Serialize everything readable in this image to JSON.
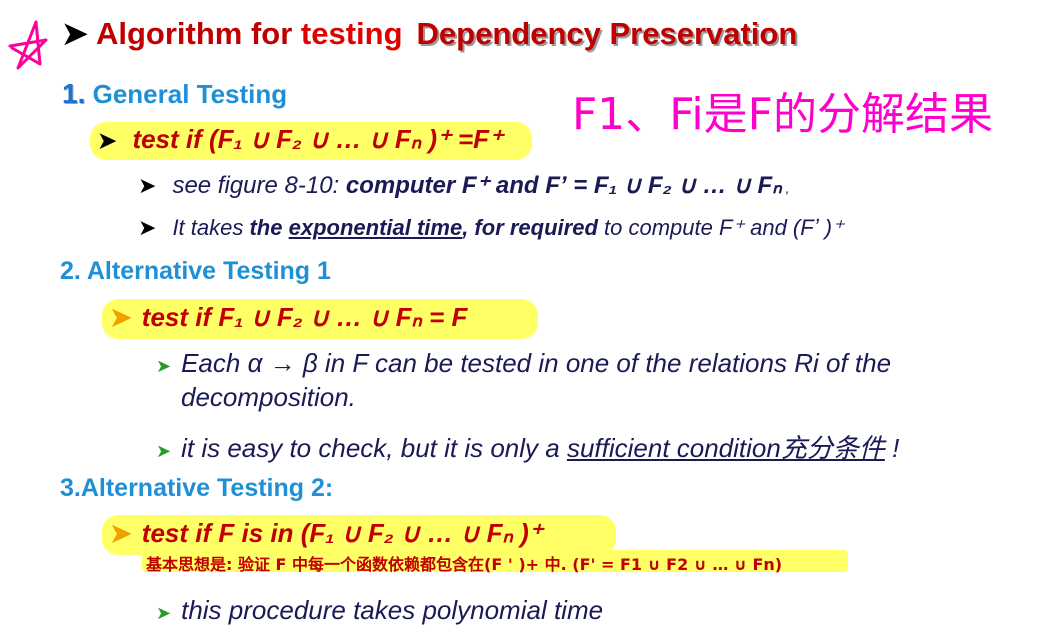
{
  "title": {
    "part1": "Algorithm for ",
    "part2": "testing",
    "part3": "Dependency Preservation"
  },
  "annotation_cn": "F1、Fi是F的分解结果",
  "section1": {
    "number": "1.",
    "label": "General Testing",
    "test": "test if (F₁ ∪ F₂ ∪ … ∪ Fₙ )⁺ =F⁺",
    "bullet1": {
      "pre": "see figure 8-10: ",
      "bold": "computer F⁺  and Fʼ = F₁ ∪ F₂ ∪ … ∪ Fₙ",
      "post": " ,"
    },
    "bullet2": {
      "pre": "It takes ",
      "b1": "the ",
      "u1": "exponential time",
      "b2": ", for required",
      "post": " to compute F⁺ and (Fʼ )⁺"
    }
  },
  "section2": {
    "label": "2. Alternative Testing 1",
    "test": "test  if  F₁ ∪ F₂ ∪ … ∪ Fₙ = F",
    "bullet1_line1": "Each α → β in F can be tested in one of the relations Ri of the",
    "bullet1_line2": "decomposition.",
    "bullet2_pre": "it is easy to check, but it is only a ",
    "bullet2_u": "sufficient condition充分条件",
    "bullet2_post": "  !"
  },
  "section3": {
    "label": "3.Alternative Testing 2:",
    "test": "test if  F is in  (F₁ ∪ F₂ ∪ … ∪ Fₙ )⁺",
    "note_cn": "基本思想是: 验证 F 中每一个函数依赖都包含在(F ' )+ 中.   (F' = F1 ∪ F2 ∪ … ∪ Fn)",
    "bullet1": "this procedure takes polynomial time"
  }
}
